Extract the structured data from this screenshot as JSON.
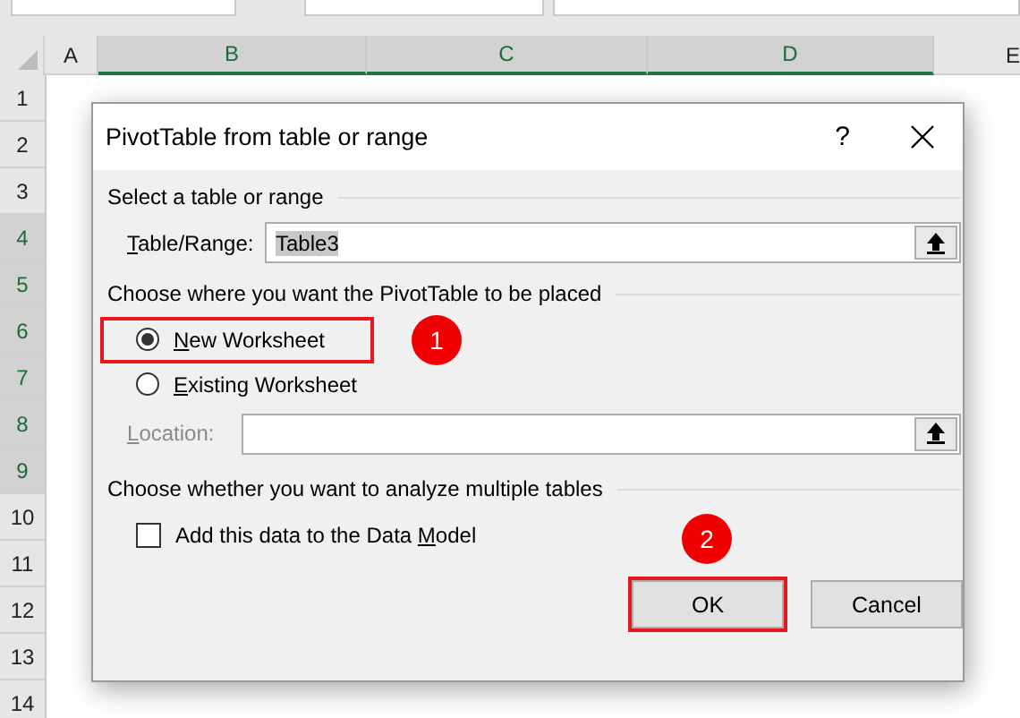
{
  "spreadsheet": {
    "columns": [
      {
        "label": "A",
        "selected": false
      },
      {
        "label": "B",
        "selected": true
      },
      {
        "label": "C",
        "selected": true
      },
      {
        "label": "D",
        "selected": true
      },
      {
        "label": "E",
        "selected": false
      }
    ],
    "rows": [
      {
        "label": "1",
        "selected": false
      },
      {
        "label": "2",
        "selected": false
      },
      {
        "label": "3",
        "selected": false
      },
      {
        "label": "4",
        "selected": true
      },
      {
        "label": "5",
        "selected": true
      },
      {
        "label": "6",
        "selected": true
      },
      {
        "label": "7",
        "selected": true
      },
      {
        "label": "8",
        "selected": true
      },
      {
        "label": "9",
        "selected": true
      },
      {
        "label": "10",
        "selected": false
      },
      {
        "label": "11",
        "selected": false
      },
      {
        "label": "12",
        "selected": false
      },
      {
        "label": "13",
        "selected": false
      },
      {
        "label": "14",
        "selected": false
      }
    ]
  },
  "dialog": {
    "title": "PivotTable from table or range",
    "help": "?",
    "source": {
      "heading": "Select a table or range",
      "field": {
        "key": "T",
        "post": "able/Range:",
        "value": "Table3",
        "value_selected": true
      }
    },
    "placement": {
      "heading": "Choose where you want the PivotTable to be placed",
      "options": [
        {
          "key": "N",
          "post": "ew Worksheet",
          "selected": true,
          "highlighted": true,
          "badge": "1"
        },
        {
          "key": "E",
          "post": "xisting Worksheet",
          "selected": false,
          "highlighted": false
        }
      ],
      "location": {
        "key": "L",
        "post": "ocation:",
        "disabled": true
      }
    },
    "tables": {
      "heading": "Choose whether you want to analyze multiple tables",
      "checkbox": {
        "pre": "Add this data to the Data ",
        "key": "M",
        "post": "odel",
        "checked": false
      }
    },
    "buttons": [
      {
        "label": "OK",
        "highlighted": true,
        "badge": "2"
      },
      {
        "label": "Cancel",
        "highlighted": false
      }
    ]
  }
}
